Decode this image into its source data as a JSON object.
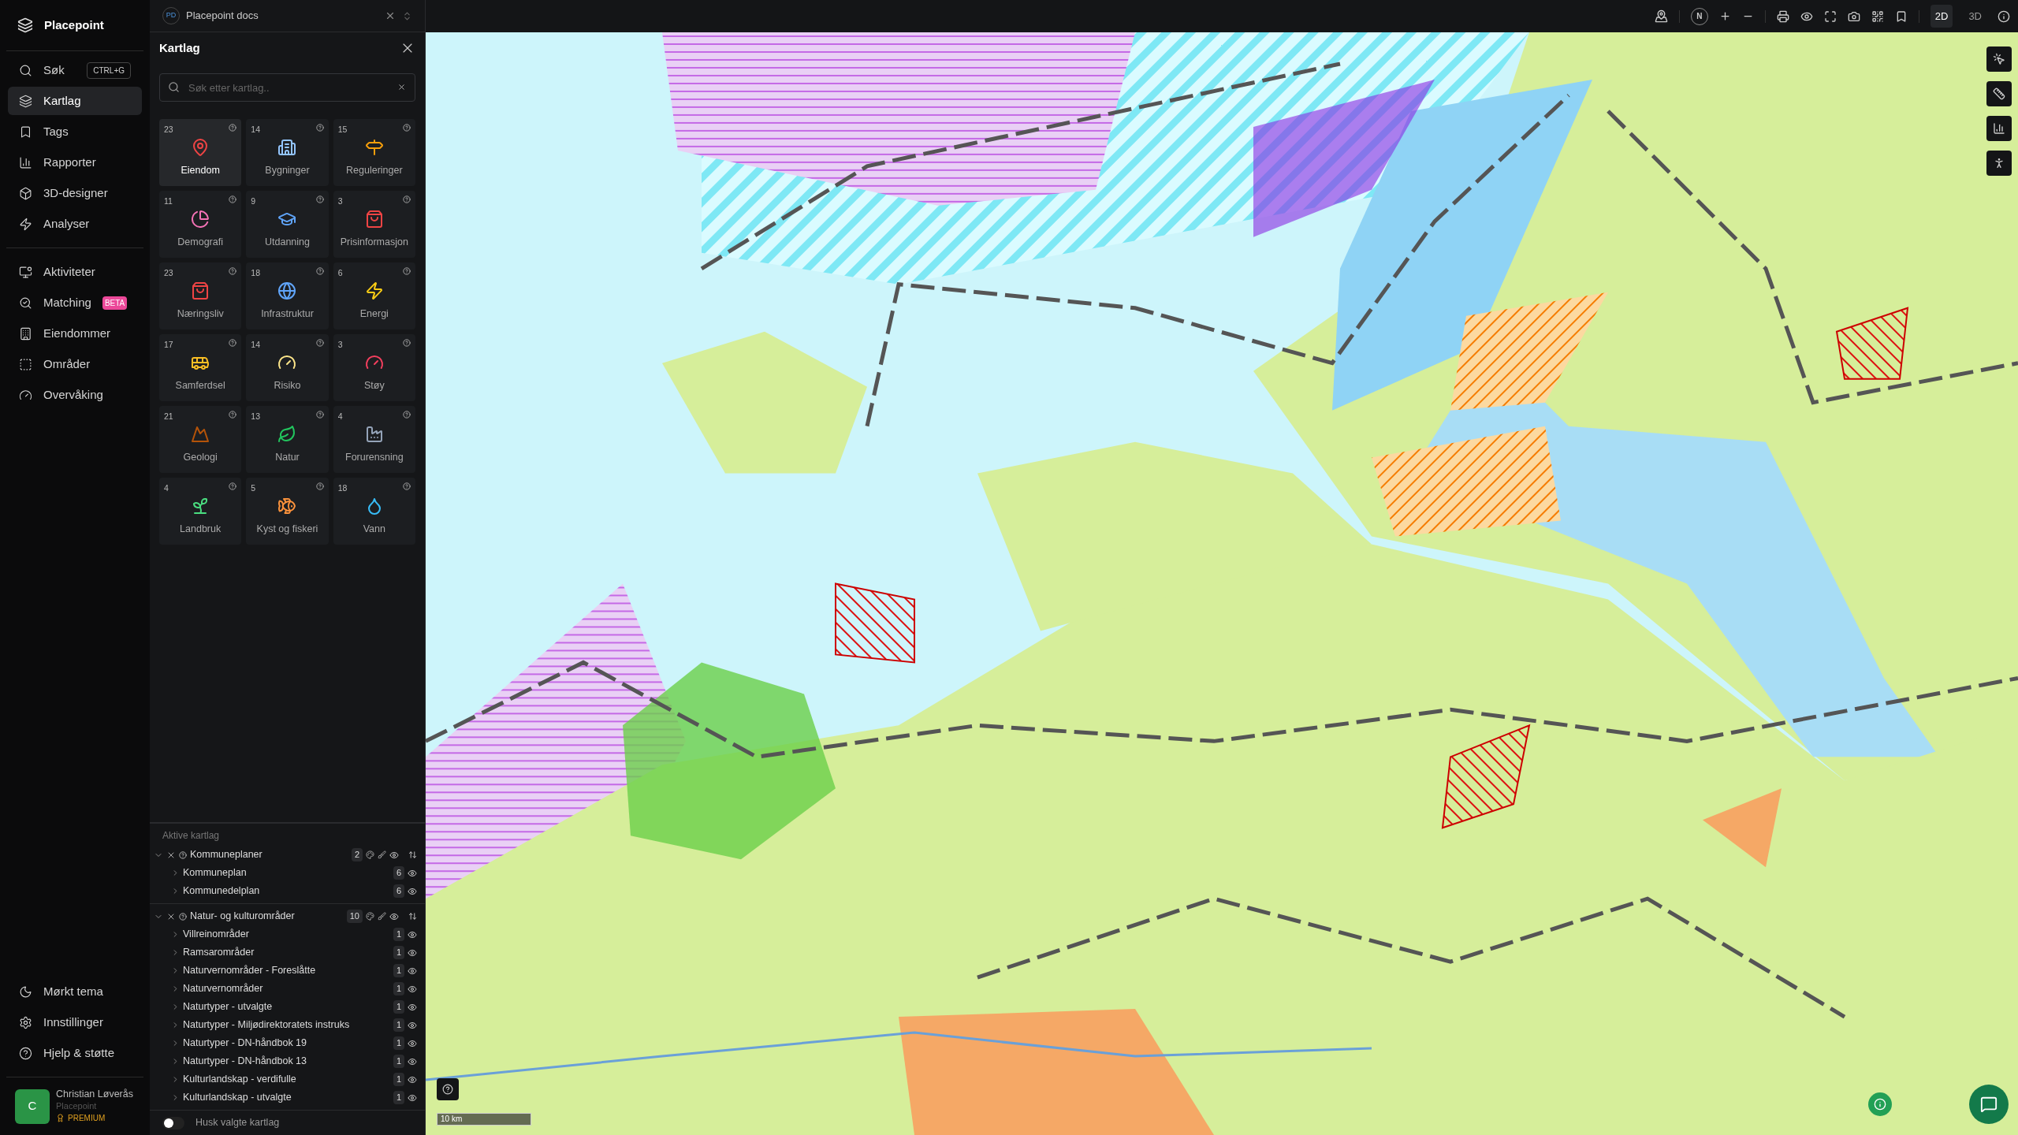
{
  "app": {
    "name": "Placepoint"
  },
  "nav_main": [
    {
      "label": "Søk",
      "shortcut": "CTRL+G",
      "selected": false
    },
    {
      "label": "Kartlag",
      "selected": true
    },
    {
      "label": "Tags",
      "selected": false
    },
    {
      "label": "Rapporter",
      "selected": false
    },
    {
      "label": "3D-designer",
      "selected": false
    },
    {
      "label": "Analyser",
      "selected": false
    }
  ],
  "nav_secondary": [
    {
      "label": "Aktiviteter",
      "selected": false
    },
    {
      "label": "Matching",
      "badge": "BETA",
      "selected": false
    },
    {
      "label": "Eiendommer",
      "selected": false
    },
    {
      "label": "Områder",
      "selected": false
    },
    {
      "label": "Overvåking",
      "selected": false
    }
  ],
  "nav_bottom": [
    {
      "label": "Mørkt tema"
    },
    {
      "label": "Innstillinger"
    },
    {
      "label": "Hjelp & støtte"
    }
  ],
  "user": {
    "initial": "C",
    "name": "Christian Løverås",
    "org": "Placepoint",
    "plan": "PREMIUM"
  },
  "workspace": {
    "initials": "PD",
    "name": "Placepoint docs"
  },
  "panel": {
    "title": "Kartlag",
    "search": {
      "placeholder": "Søk etter kartlag.."
    },
    "categories": [
      {
        "count": "23",
        "label": "Eiendom",
        "selected": true
      },
      {
        "count": "14",
        "label": "Bygninger",
        "selected": false
      },
      {
        "count": "15",
        "label": "Reguleringer",
        "selected": false
      },
      {
        "count": "11",
        "label": "Demografi",
        "selected": false
      },
      {
        "count": "9",
        "label": "Utdanning",
        "selected": false
      },
      {
        "count": "3",
        "label": "Prisinformasjon",
        "selected": false
      },
      {
        "count": "23",
        "label": "Næringsliv",
        "selected": false
      },
      {
        "count": "18",
        "label": "Infrastruktur",
        "selected": false
      },
      {
        "count": "6",
        "label": "Energi",
        "selected": false
      },
      {
        "count": "17",
        "label": "Samferdsel",
        "selected": false
      },
      {
        "count": "14",
        "label": "Risiko",
        "selected": false
      },
      {
        "count": "3",
        "label": "Støy",
        "selected": false
      },
      {
        "count": "21",
        "label": "Geologi",
        "selected": false
      },
      {
        "count": "13",
        "label": "Natur",
        "selected": false
      },
      {
        "count": "4",
        "label": "Forurensning",
        "selected": false
      },
      {
        "count": "4",
        "label": "Landbruk",
        "selected": false
      },
      {
        "count": "5",
        "label": "Kyst og fiskeri",
        "selected": false
      },
      {
        "count": "18",
        "label": "Vann",
        "selected": false
      }
    ],
    "active_title": "Aktive kartlag",
    "groups": [
      {
        "name": "Kommuneplaner",
        "count": "2",
        "expanded": true,
        "children": [
          {
            "name": "Kommuneplan",
            "count": "6",
            "expanded": false
          },
          {
            "name": "Kommunedelplan",
            "count": "6",
            "expanded": false
          }
        ]
      },
      {
        "name": "Natur- og kulturområder",
        "count": "10",
        "expanded": true,
        "children": [
          {
            "name": "Villreinområder",
            "count": "1",
            "expanded": false
          },
          {
            "name": "Ramsarområder",
            "count": "1",
            "expanded": false
          },
          {
            "name": "Naturvernområder - Foreslåtte",
            "count": "1",
            "expanded": false
          },
          {
            "name": "Naturvernområder",
            "count": "1",
            "expanded": false
          },
          {
            "name": "Naturtyper - utvalgte",
            "count": "1",
            "expanded": false
          },
          {
            "name": "Naturtyper - Miljødirektoratets instruks",
            "count": "1",
            "expanded": false
          },
          {
            "name": "Naturtyper - DN-håndbok 19",
            "count": "1",
            "expanded": false
          },
          {
            "name": "Naturtyper - DN-håndbok 13",
            "count": "1",
            "expanded": false
          },
          {
            "name": "Kulturlandskap - verdifulle",
            "count": "1",
            "expanded": false
          },
          {
            "name": "Kulturlandskap - utvalgte",
            "count": "1",
            "expanded": false
          }
        ]
      }
    ],
    "remember": {
      "label": "Husk valgte kartlag",
      "on": false
    }
  },
  "toolbar": {
    "compass": "N",
    "modes": [
      {
        "label": "2D",
        "selected": true
      },
      {
        "label": "3D",
        "selected": false
      }
    ]
  },
  "map": {
    "scale": "10 km"
  }
}
